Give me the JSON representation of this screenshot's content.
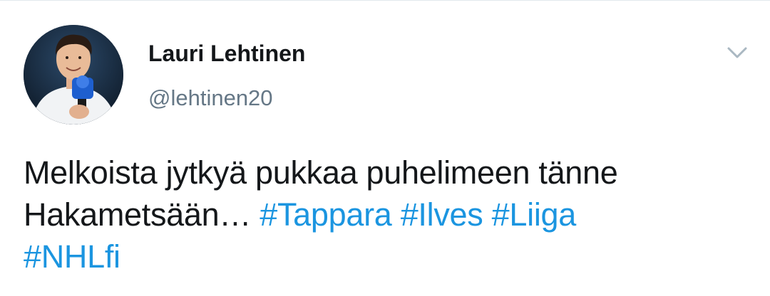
{
  "tweet": {
    "author": {
      "name": "Lauri Lehtinen",
      "handle": "@lehtinen20"
    },
    "text_parts": {
      "line1": "Melkoista jytkyä pukkaa puhelimeen tänne",
      "line2_text": "Hakametsään…"
    },
    "hashtags": [
      "#Tappara",
      "#Ilves",
      "#Liiga",
      "#NHLfi"
    ],
    "colors": {
      "hashtag": "#1b95e0",
      "text": "#14171a",
      "secondary": "#657786"
    },
    "menu_icon": "chevron-down-icon"
  }
}
